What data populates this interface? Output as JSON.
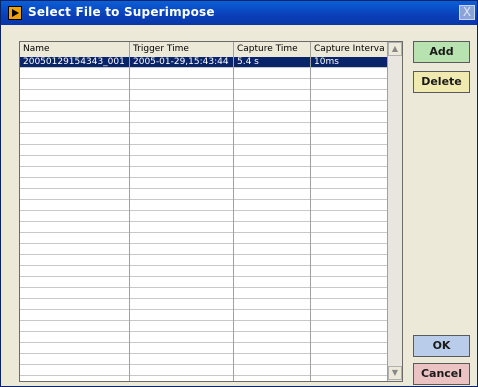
{
  "window": {
    "title": "Select File to Superimpose",
    "close_glyph": "X"
  },
  "table": {
    "columns": [
      "Name",
      "Trigger Time",
      "Capture Time",
      "Capture Interva"
    ],
    "rows": [
      [
        "20050129154343_001",
        "2005-01-29,15:43:44",
        "5.4 s",
        "10ms"
      ]
    ],
    "selected_row": 0,
    "empty_row_count": 28
  },
  "scrollbar": {
    "up_glyph": "▲",
    "down_glyph": "▼"
  },
  "buttons": {
    "add": "Add",
    "delete": "Delete",
    "ok": "OK",
    "cancel": "Cancel"
  },
  "colors": {
    "add_bg": "#b8e2b0",
    "delete_bg": "#f0eab0",
    "ok_bg": "#b9cdea",
    "cancel_bg": "#ecc3c3",
    "selection": "#0a246a"
  }
}
